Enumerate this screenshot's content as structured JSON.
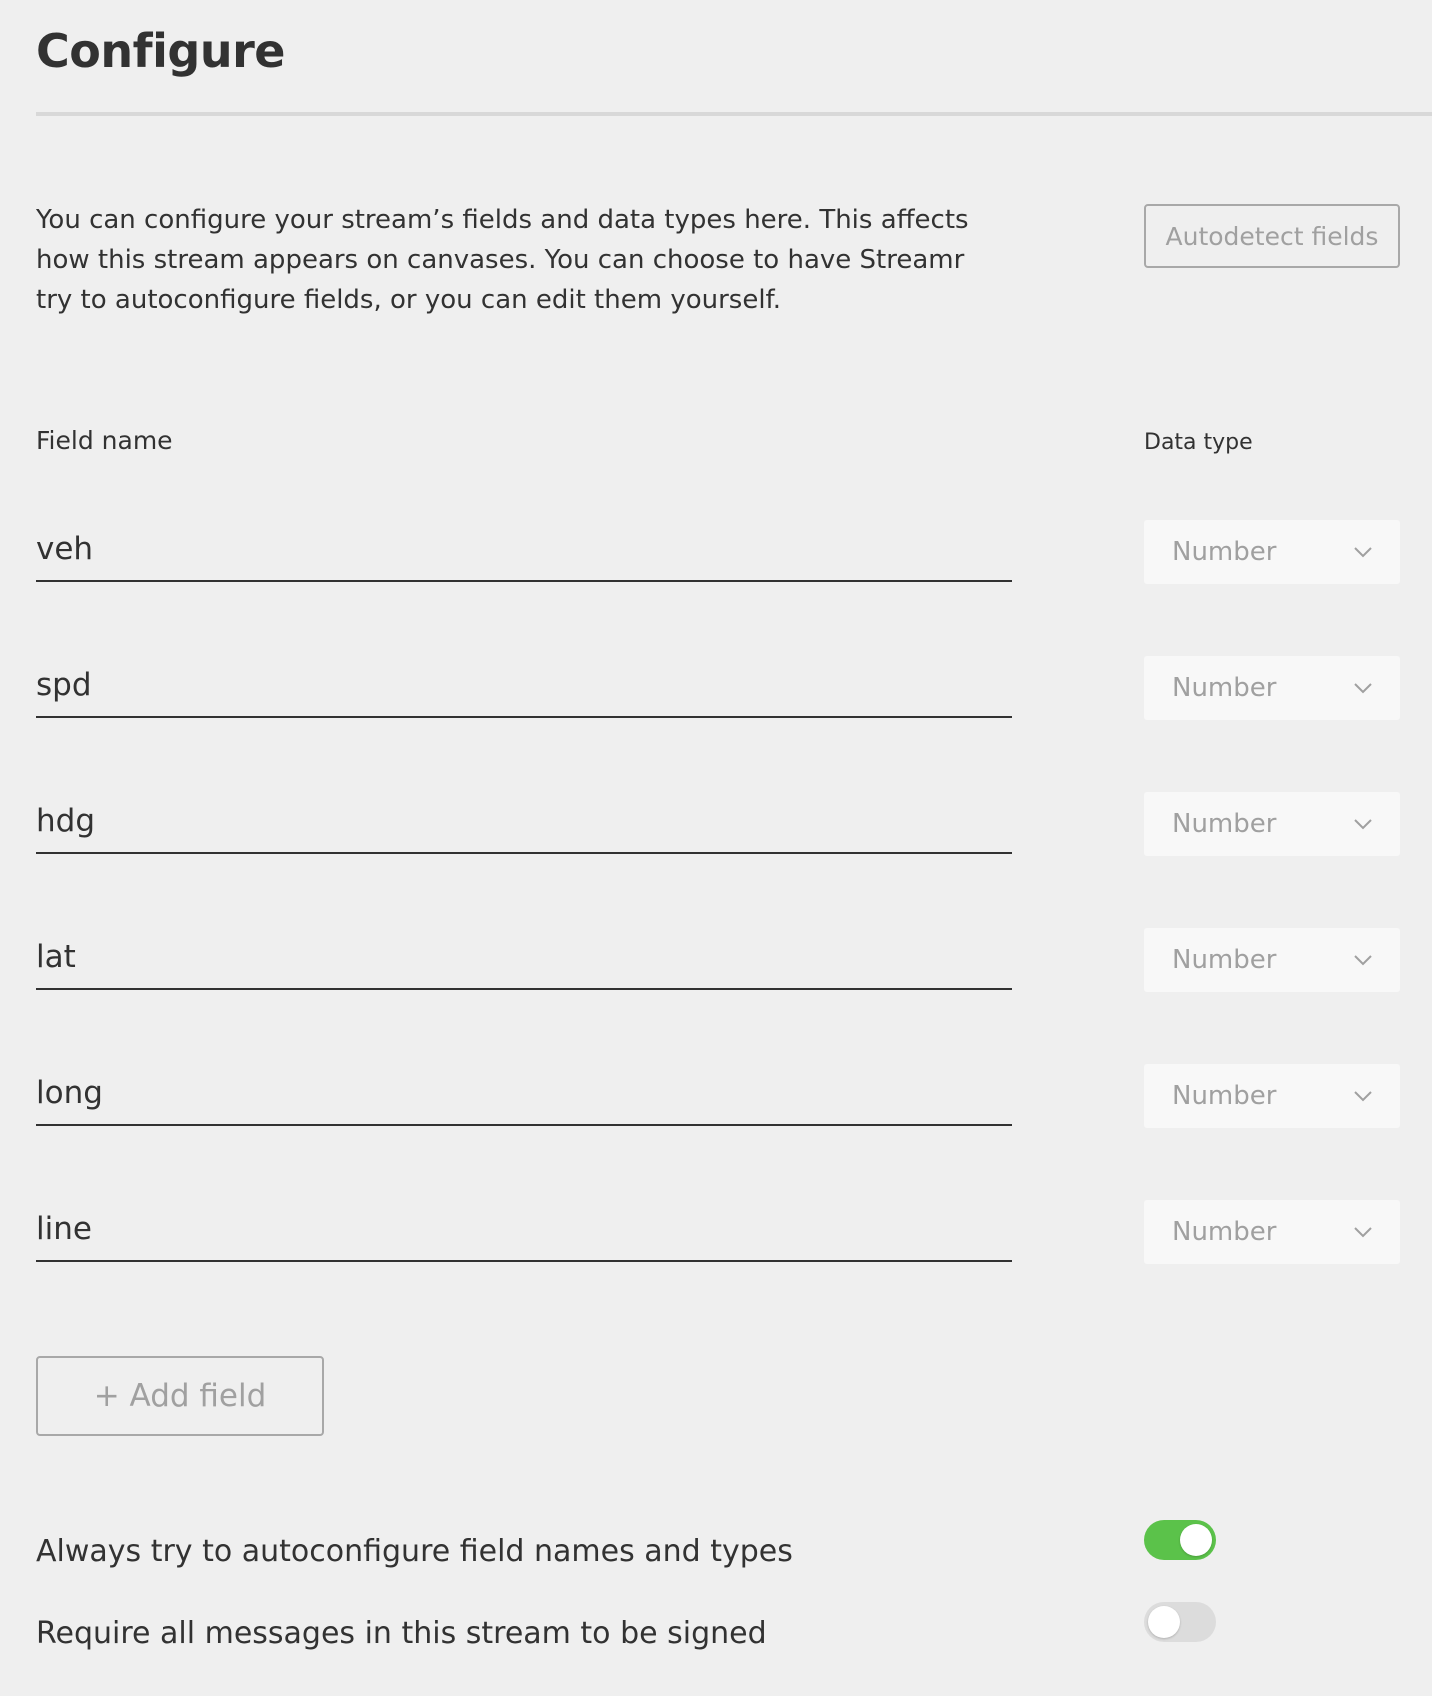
{
  "header": {
    "title": "Configure"
  },
  "intro": {
    "text": "You can configure your stream’s fields and data types here. This affects how this stream appears on canvases. You can choose to have Streamr try to autoconfigure fields, or you can edit them yourself.",
    "autodetect_label": "Autodetect fields"
  },
  "columns": {
    "field_name": "Field name",
    "data_type": "Data type"
  },
  "fields": [
    {
      "name": "veh",
      "type": "Number"
    },
    {
      "name": "spd",
      "type": "Number"
    },
    {
      "name": "hdg",
      "type": "Number"
    },
    {
      "name": "lat",
      "type": "Number"
    },
    {
      "name": "long",
      "type": "Number"
    },
    {
      "name": "line",
      "type": "Number"
    }
  ],
  "add_field_label": "+ Add field",
  "settings": {
    "autoconfigure": {
      "label": "Always try to autoconfigure field names and types",
      "enabled": true
    },
    "require_signed": {
      "label": "Require all messages in this stream to be signed",
      "enabled": false
    }
  },
  "colors": {
    "toggle_on": "#5bc24a",
    "toggle_off": "#dcdcdc",
    "background": "#efefef"
  },
  "icons": {
    "select_chevron": "chevron-down-icon"
  }
}
